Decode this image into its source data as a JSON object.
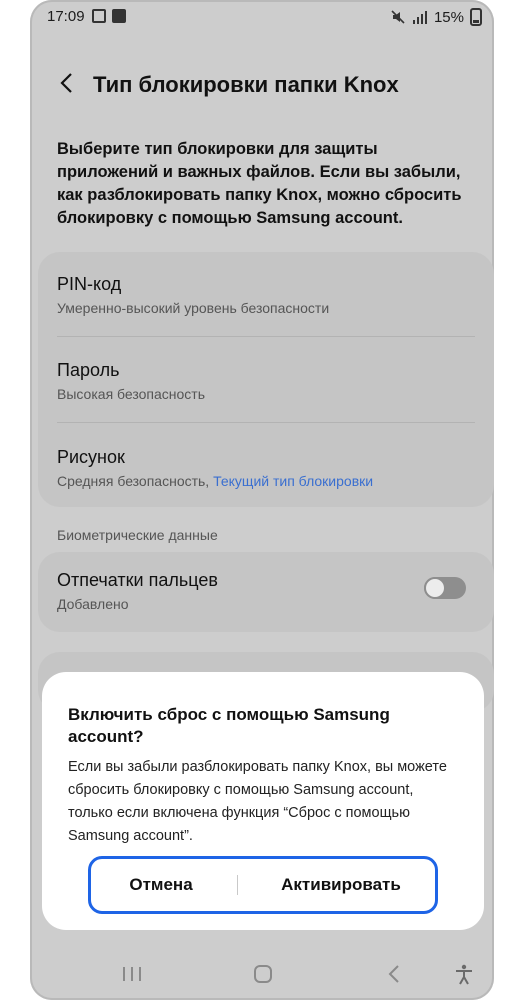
{
  "status_bar": {
    "time": "17:09",
    "battery": "15%"
  },
  "header": {
    "title": "Тип блокировки папки Knox"
  },
  "intro_text": "Выберите тип блокировки для защиты приложений и важных файлов. Если вы забыли, как разблокировать папку Knox, можно сбросить блокировку с помощью Samsung account.",
  "lock_types": [
    {
      "title": "PIN-код",
      "subtitle": "Умеренно-высокий уровень безопасности"
    },
    {
      "title": "Пароль",
      "subtitle": "Высокая безопасность"
    },
    {
      "title": "Рисунок",
      "subtitle": "Средняя безопасность,",
      "current_label": "Текущий тип блокировки"
    }
  ],
  "biometrics": {
    "section_label": "Биометрические данные",
    "fingerprints": {
      "title": "Отпечатки пальцев",
      "subtitle": "Добавлено",
      "enabled": false
    }
  },
  "dialog": {
    "title": "Включить сброс с помощью Samsung account?",
    "body": "Если вы забыли разблокировать папку Knox, вы можете сбросить блокировку с помощью Samsung account, только если включена функция “Сброс с помощью Samsung account”.",
    "cancel_label": "Отмена",
    "activate_label": "Активировать",
    "highlight_color": "#1e64e6"
  },
  "nav_icons": [
    "recents-icon",
    "home-icon",
    "back-icon",
    "accessibility-icon"
  ]
}
